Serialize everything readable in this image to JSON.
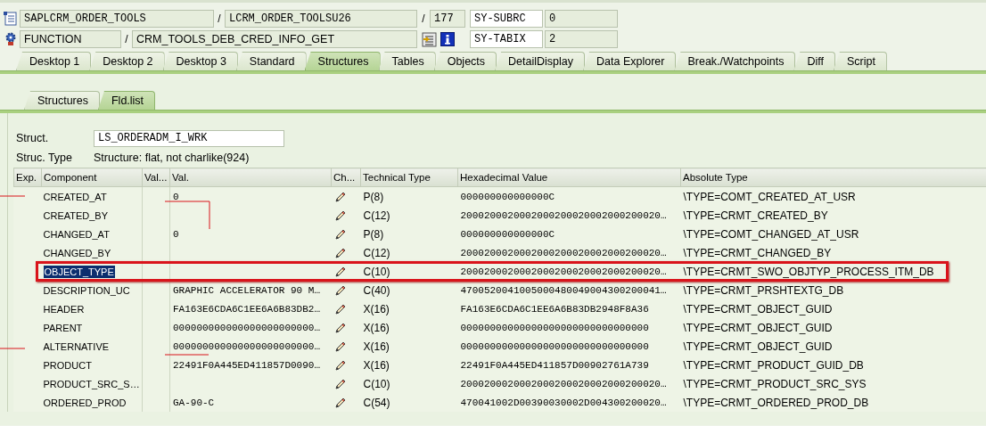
{
  "header_rows": [
    {
      "items": [
        {
          "kind": "icon"
        },
        {
          "kind": "code",
          "text": "SAPLCRM_ORDER_TOOLS"
        },
        {
          "kind": "sep",
          "text": "/"
        },
        {
          "kind": "code",
          "text": "LCRM_ORDER_TOOLSU26"
        },
        {
          "kind": "sep",
          "text": "/"
        },
        {
          "kind": "code",
          "text": "177"
        },
        {
          "kind": "label",
          "text": "SY-SUBRC"
        },
        {
          "kind": "code",
          "text": "0"
        }
      ]
    },
    {
      "items": [
        {
          "kind": "icon"
        },
        {
          "kind": "text",
          "text": "FUNCTION"
        },
        {
          "kind": "sep",
          "text": "/"
        },
        {
          "kind": "text",
          "text": "CRM_TOOLS_DEB_CRED_INFO_GET"
        },
        {
          "kind": "icon"
        },
        {
          "kind": "icon"
        },
        {
          "kind": "label",
          "text": "SY-TABIX"
        },
        {
          "kind": "code",
          "text": "2"
        }
      ]
    }
  ],
  "tabs": [
    {
      "label": "Desktop 1",
      "selected": false
    },
    {
      "label": "Desktop 2",
      "selected": false
    },
    {
      "label": "Desktop 3",
      "selected": false
    },
    {
      "label": "Standard",
      "selected": false
    },
    {
      "label": "Structures",
      "selected": true
    },
    {
      "label": "Tables",
      "selected": false
    },
    {
      "label": "Objects",
      "selected": false
    },
    {
      "label": "DetailDisplay",
      "selected": false
    },
    {
      "label": "Data Explorer",
      "selected": false
    },
    {
      "label": "Break./Watchpoints",
      "selected": false
    },
    {
      "label": "Diff",
      "selected": false
    },
    {
      "label": "Script",
      "selected": false
    }
  ],
  "sub_tabs": [
    {
      "label": "Structures",
      "selected": false
    },
    {
      "label": "Fld.list",
      "selected": true
    }
  ],
  "struct": {
    "label": "Struct.",
    "value": "LS_ORDERADM_I_WRK"
  },
  "struc_type": {
    "label": "Struc. Type",
    "value": "Structure: flat, not charlike(924)"
  },
  "table": {
    "columns": [
      "Exp.",
      "Component",
      "Val...",
      "Val.",
      "Ch...",
      "Technical Type",
      "Hexadecimal Value",
      "Absolute Type"
    ],
    "rows": [
      {
        "component": "CREATED_AT",
        "value": "0",
        "editable": true,
        "technical_type": "P(8)",
        "hex_value": "000000000000000C",
        "absolute_type": "\\TYPE=COMT_CREATED_AT_USR",
        "selected": false,
        "highlighted": false
      },
      {
        "component": "CREATED_BY",
        "editable": true,
        "technical_type": "C(12)",
        "hex_value": "2000200020002000200020002000200020…",
        "absolute_type": "\\TYPE=CRMT_CREATED_BY",
        "selected": false,
        "highlighted": false
      },
      {
        "component": "CHANGED_AT",
        "value": "0",
        "editable": true,
        "technical_type": "P(8)",
        "hex_value": "000000000000000C",
        "absolute_type": "\\TYPE=COMT_CHANGED_AT_USR",
        "selected": false,
        "highlighted": false
      },
      {
        "component": "CHANGED_BY",
        "editable": true,
        "technical_type": "C(12)",
        "hex_value": "2000200020002000200020002000200020…",
        "absolute_type": "\\TYPE=CRMT_CHANGED_BY",
        "selected": false,
        "highlighted": false
      },
      {
        "component": "OBJECT_TYPE",
        "editable": true,
        "technical_type": "C(10)",
        "hex_value": "2000200020002000200020002000200020…",
        "absolute_type": "\\TYPE=CRMT_SWO_OBJTYP_PROCESS_ITM_DB",
        "selected": true,
        "highlighted": true
      },
      {
        "component": "DESCRIPTION_UC",
        "value": "GRAPHIC ACCELERATOR 90 M…",
        "editable": true,
        "technical_type": "C(40)",
        "hex_value": "4700520041005000480049004300200041…",
        "absolute_type": "\\TYPE=CRMT_PRSHTEXTG_DB",
        "selected": false,
        "highlighted": false
      },
      {
        "component": "HEADER",
        "value": "FA163E6CDA6C1EE6A6B83DB2…",
        "editable": true,
        "technical_type": "X(16)",
        "hex_value": "FA163E6CDA6C1EE6A6B83DB2948F8A36",
        "absolute_type": "\\TYPE=CRMT_OBJECT_GUID",
        "selected": false,
        "highlighted": false
      },
      {
        "component": "PARENT",
        "value": "000000000000000000000000…",
        "editable": true,
        "technical_type": "X(16)",
        "hex_value": "00000000000000000000000000000000",
        "absolute_type": "\\TYPE=CRMT_OBJECT_GUID",
        "selected": false,
        "highlighted": false
      },
      {
        "component": "ALTERNATIVE",
        "value": "000000000000000000000000…",
        "editable": true,
        "technical_type": "X(16)",
        "hex_value": "00000000000000000000000000000000",
        "absolute_type": "\\TYPE=CRMT_OBJECT_GUID",
        "selected": false,
        "highlighted": false
      },
      {
        "component": "PRODUCT",
        "value": "22491F0A445ED411857D0090…",
        "editable": true,
        "technical_type": "X(16)",
        "hex_value": "22491F0A445ED411857D00902761A739",
        "absolute_type": "\\TYPE=CRMT_PRODUCT_GUID_DB",
        "selected": false,
        "highlighted": false
      },
      {
        "component": "PRODUCT_SRC_S…",
        "editable": true,
        "technical_type": "C(10)",
        "hex_value": "2000200020002000200020002000200020…",
        "absolute_type": "\\TYPE=CRMT_PRODUCT_SRC_SYS",
        "selected": false,
        "highlighted": false
      },
      {
        "component": "ORDERED_PROD",
        "value": "GA-90-C",
        "editable": true,
        "technical_type": "C(54)",
        "hex_value": "470041002D00390030002D004300200020…",
        "absolute_type": "\\TYPE=CRMT_ORDERED_PROD_DB",
        "selected": false,
        "highlighted": false
      }
    ]
  }
}
